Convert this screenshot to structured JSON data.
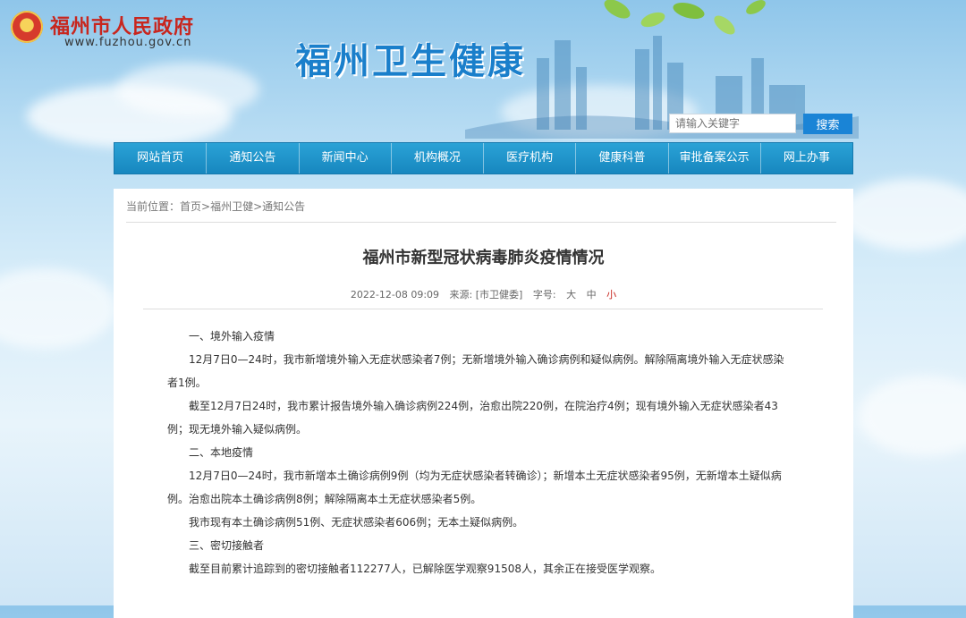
{
  "header": {
    "gov_name": "福州市人民政府",
    "gov_url": "www.fuzhou.gov.cn",
    "site_title": "福州卫生健康"
  },
  "search": {
    "placeholder": "请输入关键字",
    "button_label": "搜索"
  },
  "nav": {
    "items": [
      "网站首页",
      "通知公告",
      "新闻中心",
      "机构概况",
      "医疗机构",
      "健康科普",
      "审批备案公示",
      "网上办事"
    ]
  },
  "breadcrumb": {
    "prefix": "当前位置：",
    "items": [
      "首页",
      "福州卫健",
      "通知公告"
    ],
    "separator": ">"
  },
  "article": {
    "title": "福州市新型冠状病毒肺炎疫情情况",
    "date": "2022-12-08 09:09",
    "source": "来源: [市卫健委]",
    "font_size_label": "字号:",
    "font_large": "大",
    "font_medium": "中",
    "font_small": "小",
    "paragraphs": [
      "一、境外输入疫情",
      "12月7日0—24时，我市新增境外输入无症状感染者7例；无新增境外输入确诊病例和疑似病例。解除隔离境外输入无症状感染者1例。",
      "截至12月7日24时，我市累计报告境外输入确诊病例224例，治愈出院220例，在院治疗4例；现有境外输入无症状感染者43例；现无境外输入疑似病例。",
      "二、本地疫情",
      "12月7日0—24时，我市新增本土确诊病例9例（均为无症状感染者转确诊）；新增本土无症状感染者95例，无新增本土疑似病例。治愈出院本土确诊病例8例；解除隔离本土无症状感染者5例。",
      "我市现有本土确诊病例51例、无症状感染者606例；无本土疑似病例。",
      "三、密切接触者",
      "截至目前累计追踪到的密切接触者112277人，已解除医学观察91508人，其余正在接受医学观察。"
    ]
  },
  "colors": {
    "nav_bg": "#1a8fc9",
    "title_blue": "#1a7fcb",
    "gov_red": "#c8261e",
    "search_btn": "#1a84d6"
  }
}
